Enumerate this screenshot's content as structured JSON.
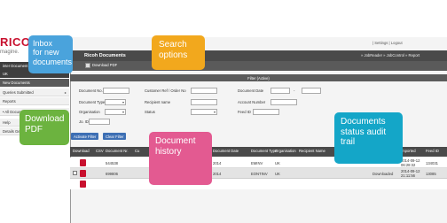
{
  "brand": {
    "logo": "RICO",
    "tagline": "magine."
  },
  "sidebar": {
    "items": [
      {
        "label": "inter Document",
        "style": "dark"
      },
      {
        "label": "UK",
        "style": "dark"
      },
      {
        "label": "New Documents",
        "style": "mid"
      },
      {
        "label": "Queries Submitted",
        "style": "light"
      },
      {
        "label": "Reports",
        "style": "light"
      },
      {
        "label": "• All Documents",
        "style": "light"
      },
      {
        "label": "Help",
        "style": "light"
      },
      {
        "label": "Details Ge...",
        "style": "light"
      }
    ]
  },
  "window": {
    "title": "Ricoh Documents",
    "top_links": "| Settings | Logout",
    "sub_links": "» JobReader » JobControl » Report",
    "toolbar_button": "Download PDF",
    "filter_bar": "Filter (Active)"
  },
  "filters": {
    "document_no": "Document No.",
    "customer_ref": "Customer Ref / Order No",
    "document_date": "Document Date",
    "document_type": "Document Type",
    "recipient_name": "Recipient name",
    "account_number": "Account Number",
    "organisation": "Organisation",
    "status": "Status",
    "feed_id": "Feed ID",
    "job_id": "Jo. ID",
    "date_sep": "-",
    "activate": "Activate Filter",
    "clear": "Clear Filter"
  },
  "table": {
    "headers": [
      "Download",
      "CSV",
      "Document Nr.",
      "Cu",
      "Document Date",
      "Document Type",
      "Organisation",
      "Recipient Name",
      "Imported",
      "Feed ID"
    ],
    "rows": [
      {
        "doc": "544538",
        "date": "2014",
        "type": "EMINV",
        "org": "UK",
        "recipient": "",
        "status": "",
        "imported": "2014-09-12 06:28:32",
        "feed": "134031"
      },
      {
        "doc": "699806",
        "date": "2014",
        "type": "EONTINV",
        "org": "UK",
        "recipient": "",
        "status": "Downloaded",
        "imported": "2014-09-12 21:11:56",
        "feed": "13085"
      },
      {
        "doc": "",
        "date": "",
        "type": "",
        "org": "",
        "recipient": "",
        "status": "",
        "imported": "",
        "feed": ""
      }
    ]
  },
  "callouts": {
    "inbox": "Inbox\nfor new\ndocuments",
    "search": "Search\noptions",
    "download": "Download\nPDF",
    "history": "Document\nhistory",
    "audit": "Documents\nstatus audit\ntrail"
  },
  "colors": {
    "brand_red": "#c8102e",
    "callout_blue": "#4aa3dc",
    "callout_orange": "#f2a81d",
    "callout_green": "#6cb33f",
    "callout_pink": "#e35a91",
    "callout_teal": "#14a6c8"
  }
}
